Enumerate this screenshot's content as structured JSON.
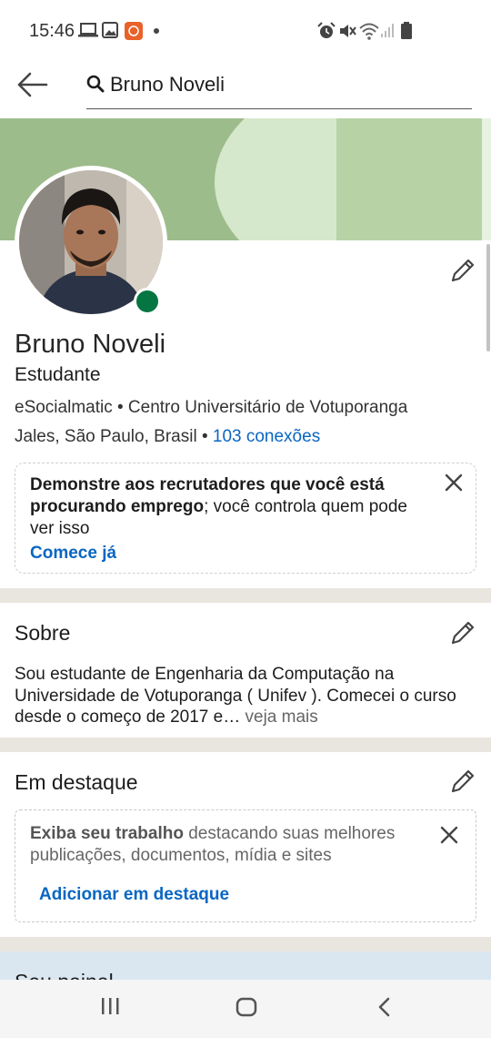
{
  "status_bar": {
    "time": "15:46",
    "icons": [
      "laptop-icon",
      "image-icon",
      "app-notification-icon",
      "dot-icon",
      "alarm-icon",
      "mute-icon",
      "wifi-icon",
      "signal-icon",
      "battery-icon"
    ],
    "notification_color": "#e8622a"
  },
  "search": {
    "value": "Bruno Noveli"
  },
  "colors": {
    "accent": "#0a66c2",
    "online": "#057642",
    "cover": "#9dbc8c",
    "divider": "#e9e5df"
  },
  "profile": {
    "name": "Bruno Noveli",
    "headline": "Estudante",
    "company_line": "eSocialmatic • Centro Universitário de Votuporanga",
    "location": "Jales, São Paulo, Brasil • ",
    "connections": "103 conexões"
  },
  "open_to_work": {
    "bold_text": "Demonstre aos recrutadores que você está procurando emprego",
    "rest_text": "; você controla quem pode ver isso",
    "cta": "Comece já"
  },
  "about": {
    "title": "Sobre",
    "text": "Sou estudante de Engenharia da Computação na Universidade de Votuporanga ( Unifev ). Comecei o curso desde o começo de 2017 e…",
    "see_more": " veja mais"
  },
  "featured": {
    "title": "Em destaque",
    "bold_text": "Exiba seu trabalho",
    "rest_text": " destacando suas melhores publicações, documentos, mídia e sites",
    "cta": "Adicionar em destaque"
  },
  "next_section": {
    "title": "Seu painel"
  },
  "nav_bar": {
    "buttons": [
      "recent-apps-icon",
      "home-icon",
      "back-nav-icon"
    ]
  }
}
